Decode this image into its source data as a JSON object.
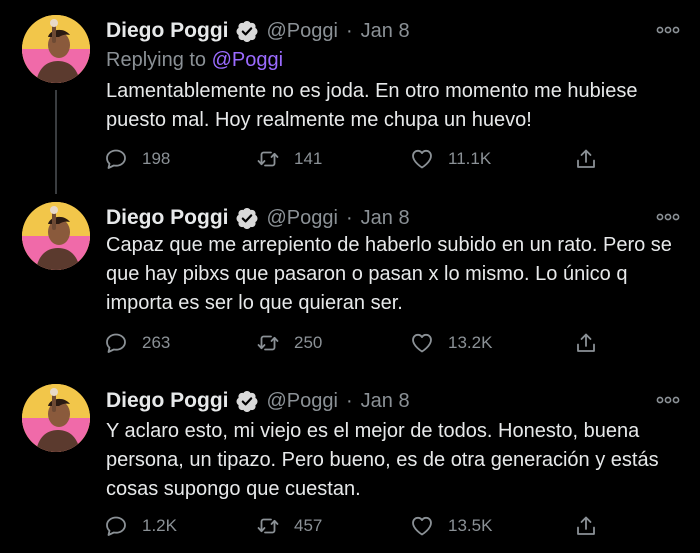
{
  "tweets": [
    {
      "name": "Diego Poggi",
      "handle": "@Poggi",
      "separator": "·",
      "date": "Jan 8",
      "replying_prefix": "Replying to ",
      "replying_to": "@Poggi",
      "text": "Lamentablemente no es joda. En otro momento me hubiese puesto mal. Hoy realmente me chupa un huevo!",
      "replies": "198",
      "retweets": "141",
      "likes": "11.1K"
    },
    {
      "name": "Diego Poggi",
      "handle": "@Poggi",
      "separator": "·",
      "date": "Jan 8",
      "text": "Capaz que me arrepiento de haberlo subido en un rato. Pero se que hay pibxs que pasaron o pasan x lo mismo. Lo único q importa es ser lo que quieran ser.",
      "replies": "263",
      "retweets": "250",
      "likes": "13.2K"
    },
    {
      "name": "Diego Poggi",
      "handle": "@Poggi",
      "separator": "·",
      "date": "Jan 8",
      "text": "Y aclaro esto, mi viejo es el mejor de todos. Honesto, buena persona, un tipazo. Pero bueno, es de otra generación y estás cosas supongo que cuestan.",
      "replies": "1.2K",
      "retweets": "457",
      "likes": "13.5K"
    }
  ],
  "icons": {
    "verified": "verified-badge-icon",
    "more": "more-icon",
    "reply": "reply-icon",
    "retweet": "retweet-icon",
    "like": "like-icon",
    "share": "share-icon"
  },
  "colors": {
    "background": "#000000",
    "text": "#e7e9ea",
    "muted": "#8b9196",
    "link": "#9b6bff",
    "avatar_bg": "#f2c64a"
  }
}
